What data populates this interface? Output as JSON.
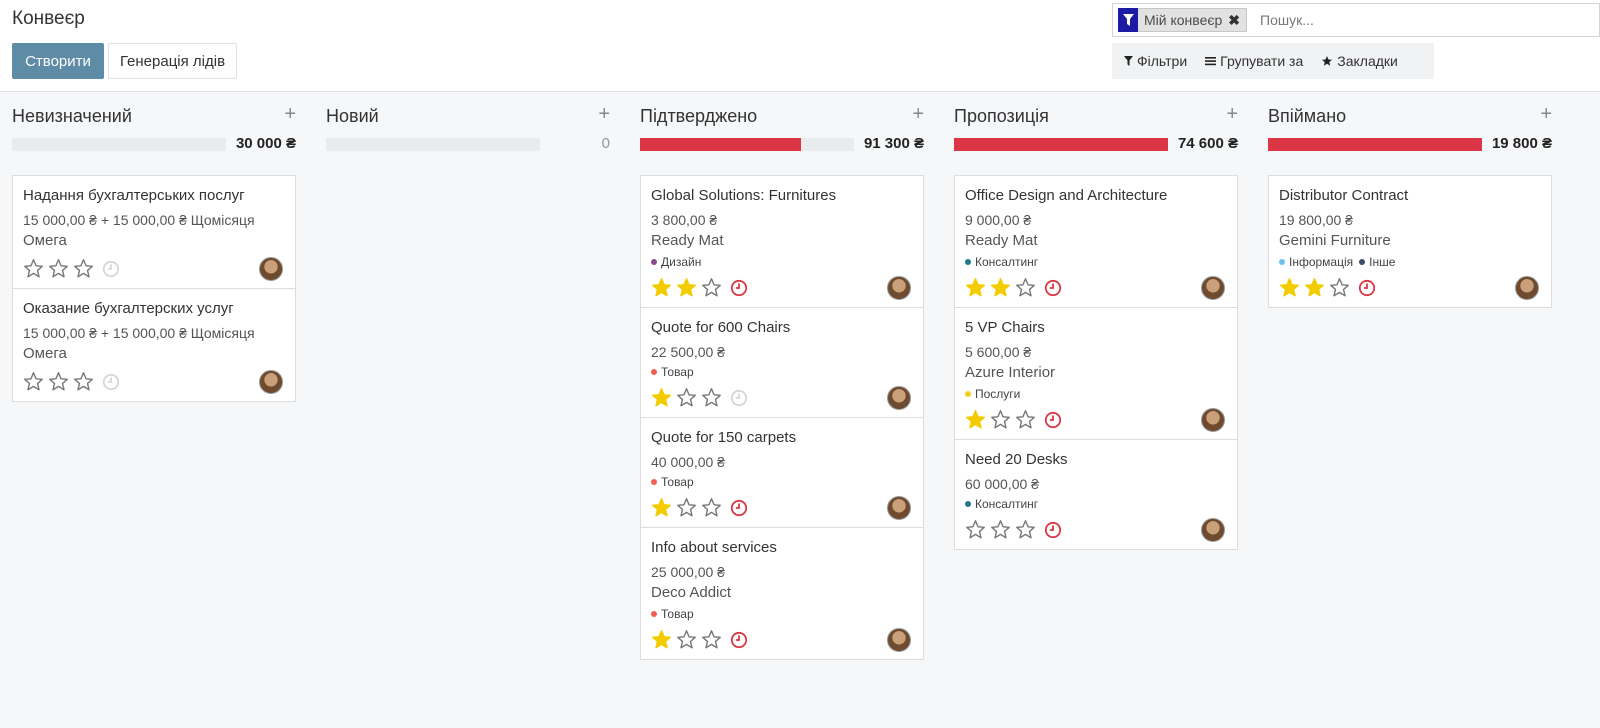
{
  "header": {
    "title": "Конвеєр",
    "create_label": "Створити",
    "leads_label": "Генерація лідів"
  },
  "search": {
    "facet_label": "Мій конвеєр",
    "placeholder": "Пошук...",
    "filters_label": "Фільтри",
    "groupby_label": "Групувати за",
    "favorites_label": "Закладки"
  },
  "colors": {
    "primary": "#5e8ca6",
    "danger": "#dc3545",
    "star": "#f3cc00",
    "clock_red": "#dc3545",
    "clock_grey": "#d6d6d6",
    "facet": "#1b1ba3"
  },
  "columns": [
    {
      "title": "Невизначений",
      "sum": "30 000 ₴",
      "progress": 0,
      "cards": [
        {
          "title": "Надання бухгалтерських послуг",
          "amount": "15 000,00 ₴ + 15 000,00 ₴ Щомісяця",
          "partner": "Омега",
          "tags": [],
          "stars": 0,
          "activity": "grey"
        },
        {
          "title": "Оказание бухгалтерских услуг",
          "amount": "15 000,00 ₴ + 15 000,00 ₴ Щомісяця",
          "partner": "Омега",
          "tags": [],
          "stars": 0,
          "activity": "grey"
        }
      ]
    },
    {
      "title": "Новий",
      "sum": "0",
      "progress": 0,
      "cards": []
    },
    {
      "title": "Підтверджено",
      "sum": "91 300 ₴",
      "progress": 0.75,
      "cards": [
        {
          "title": "Global Solutions: Furnitures",
          "amount": "3 800,00 ₴",
          "partner": "Ready Mat",
          "tags": [
            {
              "label": "Дизайн",
              "color": "#8e4a8e"
            }
          ],
          "stars": 2,
          "activity": "red"
        },
        {
          "title": "Quote for 600 Chairs",
          "amount": "22 500,00 ₴",
          "partner": "",
          "tags": [
            {
              "label": "Товар",
              "color": "#f06050"
            }
          ],
          "stars": 1,
          "activity": "grey"
        },
        {
          "title": "Quote for 150 carpets",
          "amount": "40 000,00 ₴",
          "partner": "",
          "tags": [
            {
              "label": "Товар",
              "color": "#f06050"
            }
          ],
          "stars": 1,
          "activity": "red"
        },
        {
          "title": "Info about services",
          "amount": "25 000,00 ₴",
          "partner": "Deco Addict",
          "tags": [
            {
              "label": "Товар",
              "color": "#f06050"
            }
          ],
          "stars": 1,
          "activity": "red"
        }
      ]
    },
    {
      "title": "Пропозиція",
      "sum": "74 600 ₴",
      "progress": 1,
      "cards": [
        {
          "title": "Office Design and Architecture",
          "amount": "9 000,00 ₴",
          "partner": "Ready Mat",
          "tags": [
            {
              "label": "Консалтинг",
              "color": "#1f7a8c"
            }
          ],
          "stars": 2,
          "activity": "red"
        },
        {
          "title": "5 VP Chairs",
          "amount": "5 600,00 ₴",
          "partner": "Azure Interior",
          "tags": [
            {
              "label": "Послуги",
              "color": "#f7cd1f"
            }
          ],
          "stars": 1,
          "activity": "red"
        },
        {
          "title": "Need 20 Desks",
          "amount": "60 000,00 ₴",
          "partner": "",
          "tags": [
            {
              "label": "Консалтинг",
              "color": "#1f7a8c"
            }
          ],
          "stars": 0,
          "activity": "red"
        }
      ]
    },
    {
      "title": "Впіймано",
      "sum": "19 800 ₴",
      "progress": 1,
      "cards": [
        {
          "title": "Distributor Contract",
          "amount": "19 800,00 ₴",
          "partner": "Gemini Furniture",
          "tags": [
            {
              "label": "Інформація",
              "color": "#6cc1ed"
            },
            {
              "label": "Інше",
              "color": "#3c4a6b"
            }
          ],
          "stars": 2,
          "activity": "red"
        }
      ]
    }
  ]
}
